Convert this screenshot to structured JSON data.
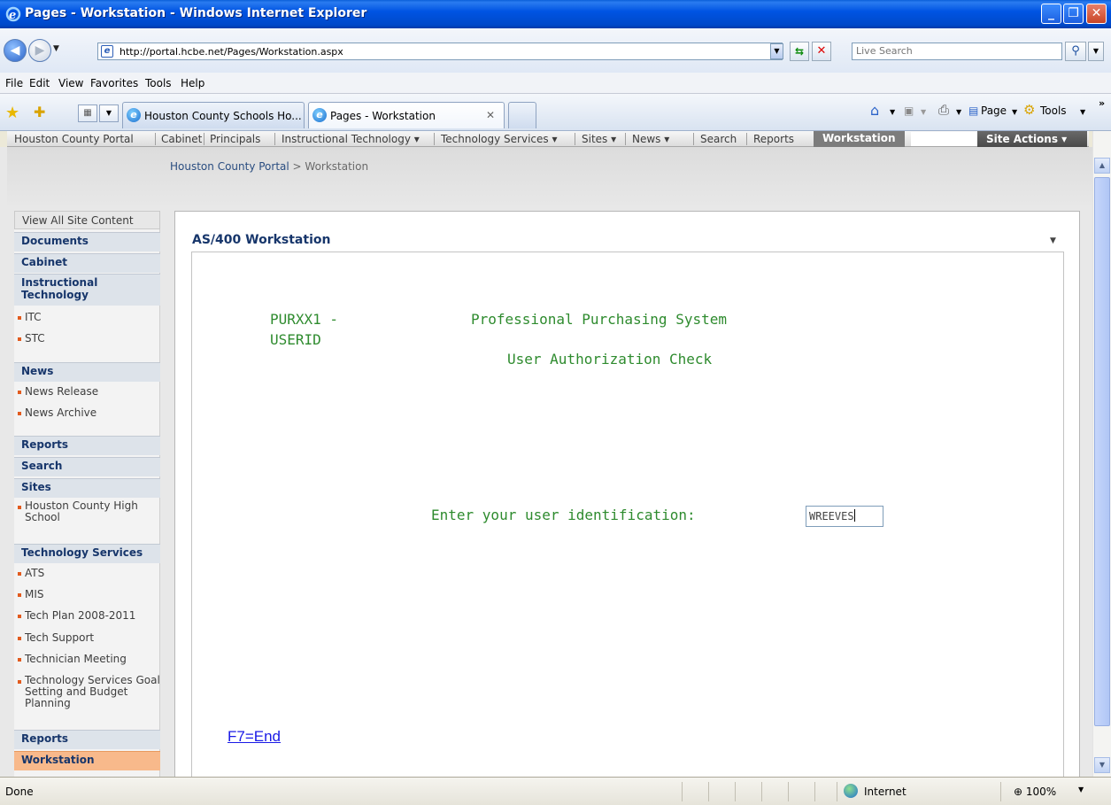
{
  "window": {
    "title": "Pages - Workstation - Windows Internet Explorer",
    "minimize": "_",
    "maximize": "❐",
    "close": "✕"
  },
  "address": {
    "url": "http://portal.hcbe.net/Pages/Workstation.aspx",
    "search_placeholder": "Live Search"
  },
  "menu": [
    "File",
    "Edit",
    "View",
    "Favorites",
    "Tools",
    "Help"
  ],
  "tabs": [
    {
      "label": "Houston County Schools Ho..."
    },
    {
      "label": "Pages - Workstation"
    }
  ],
  "commands": {
    "page": "Page",
    "tools": "Tools"
  },
  "topnav": {
    "items": [
      "Houston County Portal",
      "Cabinet",
      "Principals",
      "Instructional Technology ▾",
      "Technology Services ▾",
      "Sites ▾",
      "News ▾",
      "Search",
      "Reports"
    ],
    "active": "Workstation",
    "site_actions": "Site Actions ▾"
  },
  "breadcrumb": {
    "root": "Houston County Portal",
    "sep": " > ",
    "current": "Workstation"
  },
  "quicklaunch": {
    "view_all": "View All Site Content",
    "documents": "Documents",
    "cabinet": "Cabinet",
    "instr_tech": "Instructional Technology",
    "itc": "ITC",
    "stc": "STC",
    "news": "News",
    "news_release": "News Release",
    "news_archive": "News Archive",
    "reports": "Reports",
    "search": "Search",
    "sites": "Sites",
    "hchs": "Houston County High School",
    "tech_services": "Technology Services",
    "ats": "ATS",
    "mis": "MIS",
    "tech_plan": "Tech Plan 2008-2011",
    "tech_support": "Tech Support",
    "tech_meeting": "Technician Meeting",
    "tech_goal": "Technology Services Goal Setting and Budget Planning",
    "reports2": "Reports",
    "workstation": "Workstation"
  },
  "webpart": {
    "title": "AS/400 Workstation",
    "program": "PURXX1 -",
    "userid_label": "USERID",
    "system_title": "Professional Purchasing System",
    "subtitle": "User Authorization Check",
    "prompt": "Enter your user identification:",
    "user_value": "WREEVES",
    "f7": "F7=End"
  },
  "status": {
    "text": "Done",
    "zone": "Internet",
    "zoom": "100%"
  }
}
